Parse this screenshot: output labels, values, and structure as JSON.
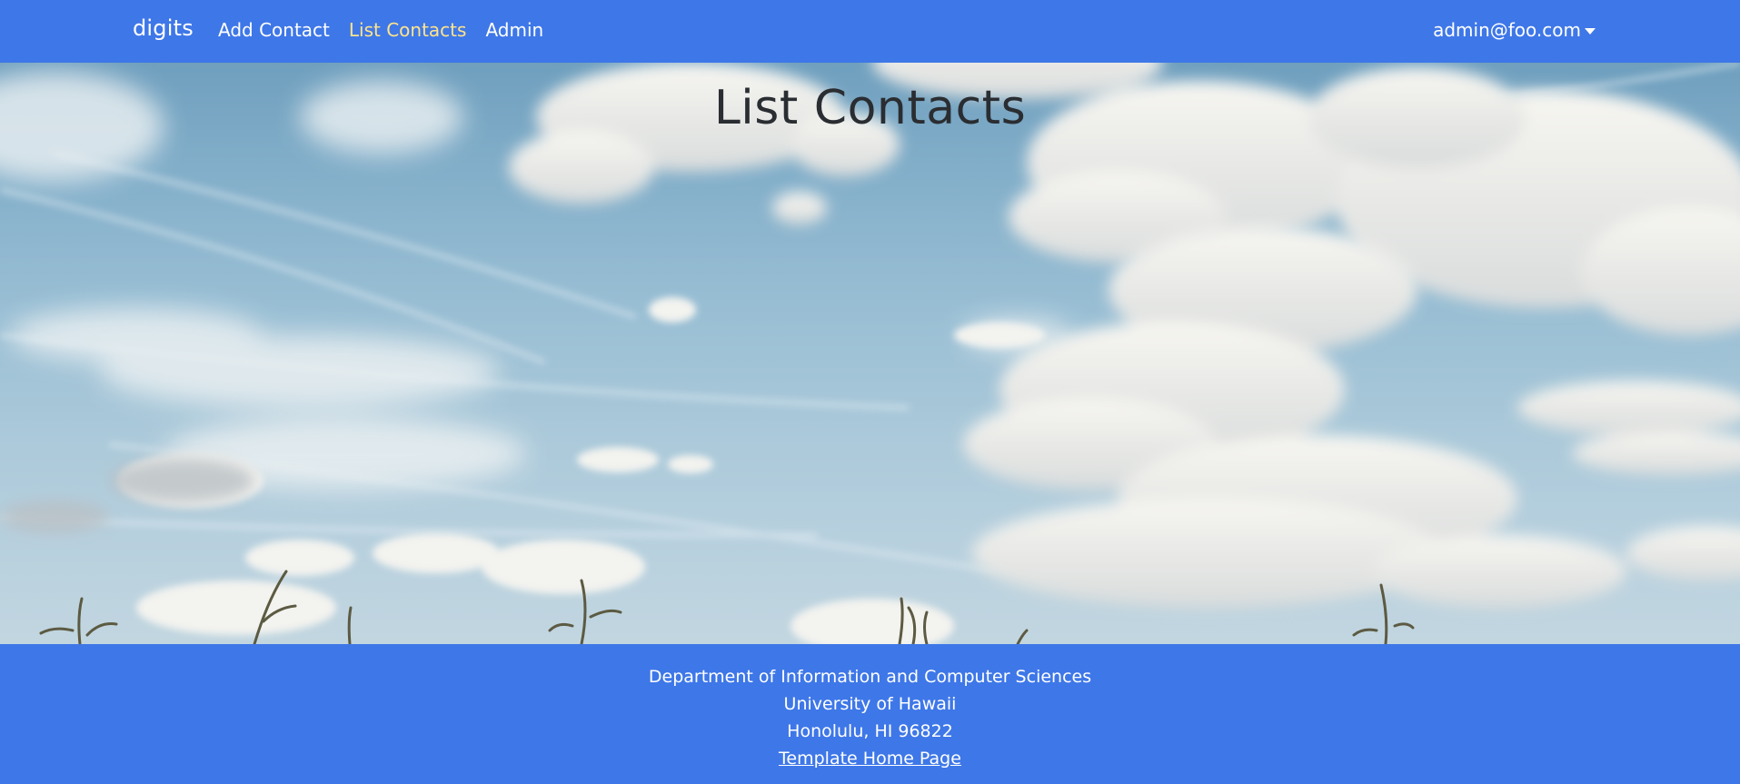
{
  "navbar": {
    "brand": "digits",
    "links": [
      {
        "label": "Add Contact",
        "active": false
      },
      {
        "label": "List Contacts",
        "active": true
      },
      {
        "label": "Admin",
        "active": false
      }
    ],
    "user": "admin@foo.com",
    "user_icon": "caret-down-icon"
  },
  "main": {
    "title": "List Contacts"
  },
  "footer": {
    "line1": "Department of Information and Computer Sciences",
    "line2": "University of Hawaii",
    "line3": "Honolulu, HI 96822",
    "link": "Template Home Page"
  },
  "colors": {
    "brand_blue": "#3e77e8",
    "active_link": "#ffe48a",
    "title_text": "#2a2d31"
  }
}
